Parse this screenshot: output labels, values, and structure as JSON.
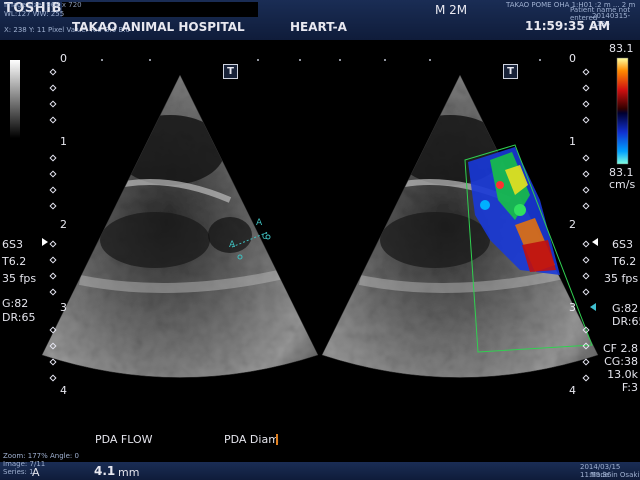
{
  "header": {
    "brand": "TOSHIBA",
    "image_size": "Image size: 960 x 720",
    "wl_ww": "WL:127 WW: 255",
    "pixel_value": "X: 238 Y: 11 Pixel Value: R:0 G:0 B:0",
    "hospital": "TAKAO ANIMAL HOSPITAL",
    "preset": "HEART-A",
    "mode": "M 2M",
    "right_info_1": "TAKAO POME OHA 1:H01 :2 m ... 2 m",
    "right_info_2": "Patient name not entered",
    "date_id": "20140315-1136",
    "time": "11:59:35 AM"
  },
  "left_panel": {
    "depth_labels": [
      "0",
      "1",
      "2",
      "3",
      "4"
    ],
    "t_marker": "T",
    "params": [
      "6S3",
      "T6.2",
      "35 fps",
      "G:82",
      "DR:65"
    ],
    "caliper_marks": [
      "A",
      "A",
      "C"
    ]
  },
  "right_panel": {
    "depth_labels": [
      "0",
      "1",
      "2",
      "3",
      "4"
    ],
    "t_marker": "T",
    "colorbar_top": "83.1",
    "colorbar_bottom": "83.1",
    "colorbar_unit": "cm/s",
    "params": [
      "6S3",
      "T6.2",
      "35 fps",
      "G:82",
      "DR:65",
      "CF 2.8",
      "CG:38",
      "13.0k",
      "F:3"
    ]
  },
  "annotations": {
    "pda_flow": "PDA FLOW",
    "pda_diam": "PDA Diam"
  },
  "footer": {
    "zoom": "Zoom: 177% Angle: 0",
    "image_count": "Image: 7/11",
    "series": "Series: 1",
    "measure_letter": "A",
    "measure_value": "4.1",
    "measure_unit": "mm",
    "timestamp": "2014/03/15 11:59:36",
    "made_in": "Made in Osaki"
  },
  "colors": {
    "header_bg": "#1a2d55",
    "caliper": "#40c0c0",
    "color_box": "#30d050"
  }
}
